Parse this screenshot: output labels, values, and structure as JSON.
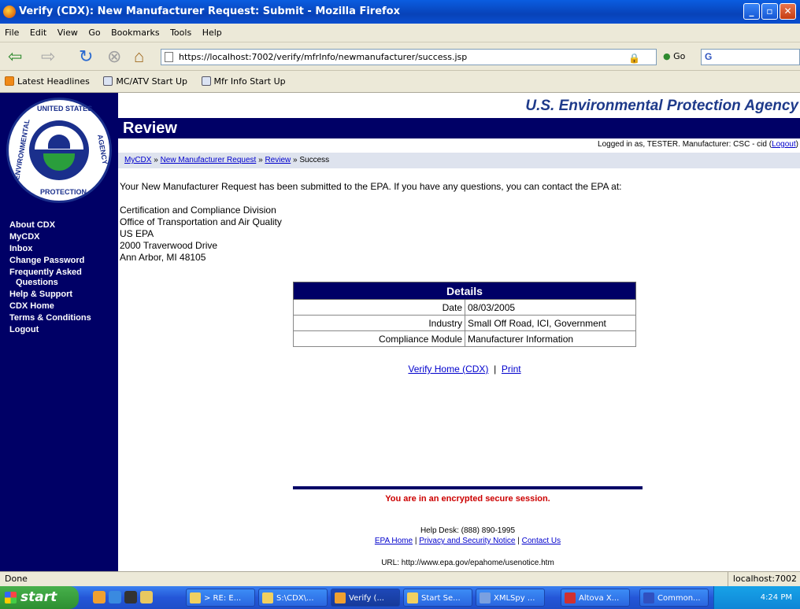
{
  "window": {
    "title": "Verify (CDX): New Manufacturer Request: Submit - Mozilla Firefox"
  },
  "menu": [
    "File",
    "Edit",
    "View",
    "Go",
    "Bookmarks",
    "Tools",
    "Help"
  ],
  "nav": {
    "url": "https://localhost:7002/verify/mfrInfo/newmanufacturer/success.jsp",
    "go_label": "Go",
    "search_value": "G"
  },
  "bookmarks": [
    "Latest Headlines",
    "MC/ATV Start Up",
    "Mfr Info Start Up"
  ],
  "sidebar": {
    "seal_top": "UNITED STATES",
    "seal_bottom": "PROTECTION",
    "seal_left": "ENVIRONMENTAL",
    "seal_right": "AGENCY",
    "items": [
      "About CDX",
      "MyCDX",
      "Inbox",
      "Change Password",
      "Frequently Asked",
      "Questions",
      "Help & Support",
      "CDX Home",
      "Terms & Conditions",
      "Logout"
    ]
  },
  "header": {
    "agency": "U.S. Environmental Protection Agency",
    "review": "Review",
    "logged_in": "Logged in as, TESTER. Manufacturer: CSC - cid (",
    "logout": "Logout"
  },
  "breadcrumb": {
    "items": [
      "MyCDX",
      "New Manufacturer Request",
      "Review"
    ],
    "current": "Success",
    "sep": "»"
  },
  "main": {
    "message": "Your New Manufacturer Request has been submitted to the EPA. If you have any questions, you can contact the EPA at:",
    "address": [
      "Certification and Compliance Division",
      "Office of Transportation and Air Quality",
      "US EPA",
      "2000 Traverwood Drive",
      "Ann Arbor, MI 48105"
    ]
  },
  "details": {
    "heading": "Details",
    "rows": [
      {
        "label": "Date",
        "value": "08/03/2005"
      },
      {
        "label": "Industry",
        "value": "Small Off Road, ICI, Government"
      },
      {
        "label": "Compliance Module",
        "value": "Manufacturer Information"
      }
    ]
  },
  "links": {
    "home": "Verify Home (CDX)",
    "sep": "|",
    "print": "Print"
  },
  "footer": {
    "secure": "You are in an encrypted secure session.",
    "helpdesk": "Help Desk: (888) 890-1995",
    "epa_home": "EPA Home",
    "privacy": "Privacy and Security Notice",
    "contact": "Contact Us",
    "url_note": "URL: http://www.epa.gov/epahome/usenotice.htm"
  },
  "status": {
    "left": "Done",
    "right": "localhost:7002"
  },
  "taskbar": {
    "start": "start",
    "tasks": [
      "> RE: E...",
      "S:\\CDX\\...",
      "Verify (...",
      "Start Se...",
      "XMLSpy ...",
      "Altova X...",
      "Common..."
    ],
    "clock": "4:24 PM"
  }
}
